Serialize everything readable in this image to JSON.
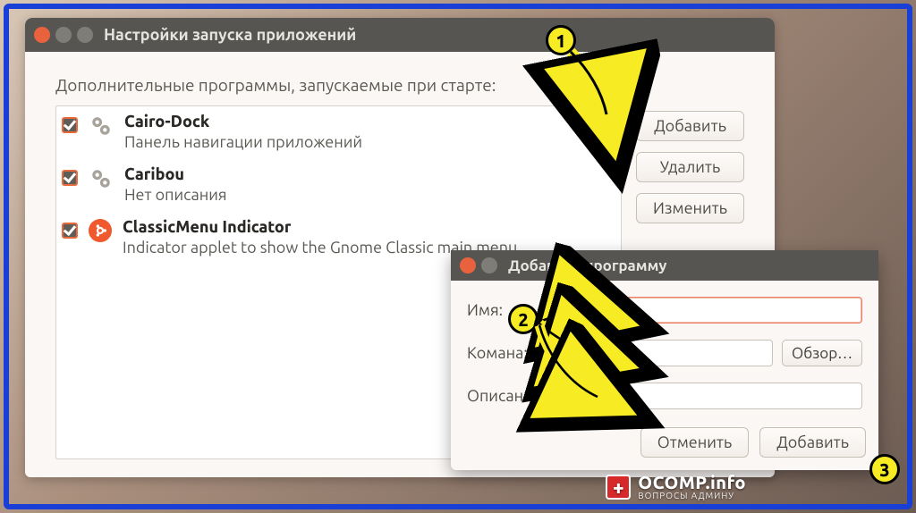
{
  "main": {
    "title": "Настройки запуска приложений",
    "header": "Дополнительные программы, запускаемые при старте:",
    "items": [
      {
        "name": "Cairo-Dock",
        "desc": "Панель навигации приложений",
        "icon": "gears"
      },
      {
        "name": "Caribou",
        "desc": "Нет описания",
        "icon": "gears"
      },
      {
        "name": "ClassicMenu Indicator",
        "desc": "Indicator applet to show the Gnome Classic main menu",
        "icon": "ubuntu"
      }
    ],
    "buttons": {
      "add": "Добавить",
      "remove": "Удалить",
      "edit": "Изменить"
    }
  },
  "dialog": {
    "title": "Добавить программу",
    "labels": {
      "name": "Имя:",
      "cmd": "Комана:",
      "desc": "Описание:",
      "browse": "Обзор…"
    },
    "values": {
      "name": "",
      "cmd": "",
      "desc": ""
    },
    "buttons": {
      "cancel": "Отменить",
      "add": "Добавить"
    }
  },
  "callouts": {
    "b1": "1",
    "b2": "2",
    "b3": "3"
  },
  "watermark": {
    "line1": "OCOMP.info",
    "line2": "ВОПРОСЫ АДМИНУ"
  }
}
